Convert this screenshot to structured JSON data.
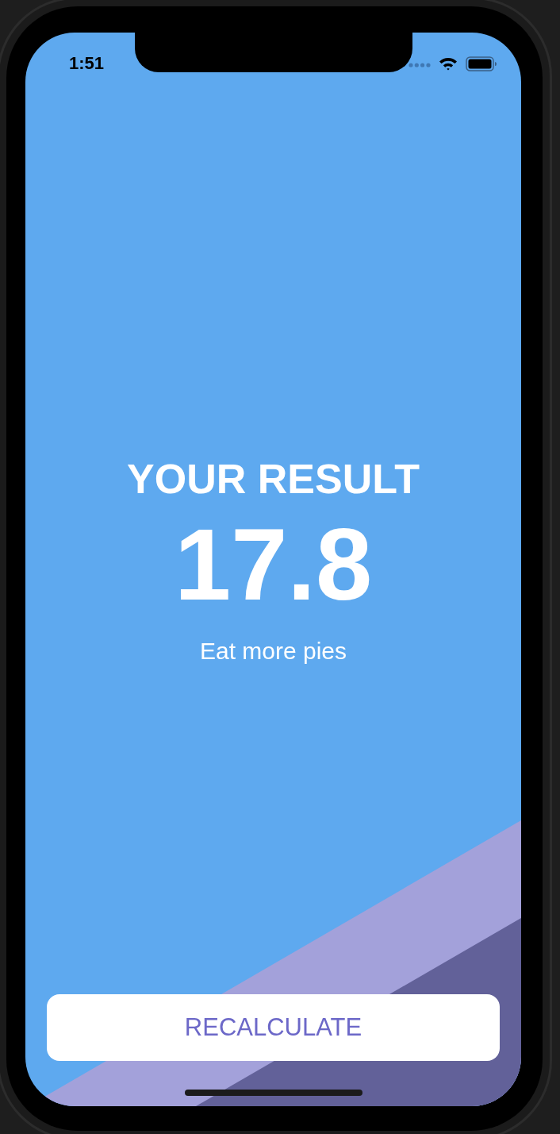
{
  "status_bar": {
    "time": "1:51"
  },
  "result": {
    "title": "YOUR RESULT",
    "value": "17.8",
    "advice": "Eat more pies"
  },
  "button": {
    "label": "RECALCULATE"
  }
}
